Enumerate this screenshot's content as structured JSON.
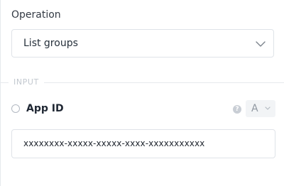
{
  "operation": {
    "label": "Operation",
    "selected": "List groups",
    "dropdown_icon": "chevron-down-icon"
  },
  "input_section": {
    "title": "INPUT"
  },
  "app_id_field": {
    "label": "App ID",
    "help_icon": "question-circle-icon",
    "help_glyph": "?",
    "type_selector": "A",
    "value": "xxxxxxxx-xxxxx-xxxxx-xxxx-xxxxxxxxxxx"
  }
}
